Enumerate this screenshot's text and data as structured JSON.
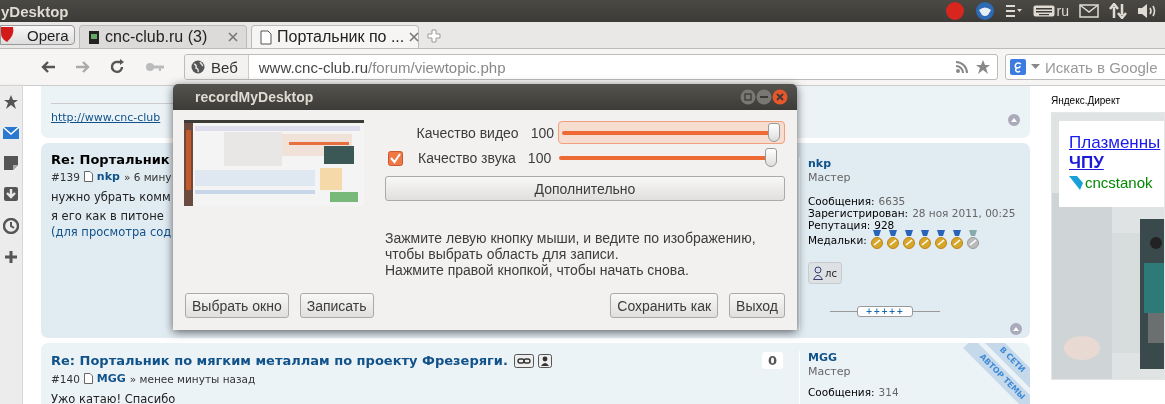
{
  "top_panel": {
    "title": "yDesktop",
    "keyboard_layout": "ru"
  },
  "browser": {
    "opera_button": "Opera",
    "tabs": [
      {
        "label": "cnc-club.ru (3)",
        "selected": false
      },
      {
        "label": "Портальник по ...",
        "selected": true
      }
    ],
    "address": {
      "scope": "Веб",
      "domain": "www.cnc-club.ru",
      "path": "/forum/viewtopic.php"
    },
    "search": {
      "placeholder": "Искать в Google"
    }
  },
  "posts": [
    {
      "kind": "tail",
      "link": "http://www.cnc-club"
    },
    {
      "kind": "post",
      "title": "Re: Портальник",
      "number": "#139",
      "author": "nkp",
      "time": "» 6 мину",
      "body": [
        "нужно убрать комм",
        "я его как в питоне"
      ],
      "hidden_note": "(для просмотра сод",
      "profile": {
        "name": "nkp",
        "rank": "Мастер",
        "stats": [
          {
            "label": "Сообщения:",
            "value": "6635"
          },
          {
            "label": "Зарегистрирован:",
            "value": "28 ноя 2011, 00:25"
          },
          {
            "label": "Репутация:",
            "value": "928"
          }
        ],
        "medals_label": "Медальки:",
        "medals": [
          {
            "kind": "gold"
          },
          {
            "kind": "gold"
          },
          {
            "kind": "gold"
          },
          {
            "kind": "gold"
          },
          {
            "kind": "gold"
          },
          {
            "kind": "gold"
          },
          {
            "kind": "silver"
          }
        ],
        "pm_button": "лс",
        "rating": "+++++"
      }
    },
    {
      "kind": "post",
      "title": "Re: Портальник по мягким металлам по проекту Фрезеряги.",
      "count": "0",
      "number": "#140",
      "author": "MGG",
      "time": "» менее минуты назад",
      "body": [
        "Ужо катаю! Спасибо"
      ],
      "profile": {
        "name": "MGG",
        "rank": "Мастер",
        "stats": [
          {
            "label": "Сообщения:",
            "value": "314"
          }
        ],
        "ribbon": [
          "В СЕТИ",
          "АВТОР ТЕМЫ"
        ]
      }
    }
  ],
  "ad": {
    "label": "Яндекс.Директ",
    "title_lines": [
      "Плазменны",
      "ЧПУ"
    ],
    "domain": "cncstanok"
  },
  "dialog": {
    "title": "recordMyDesktop",
    "sliders": [
      {
        "kind": "plain",
        "label": "Качество видео",
        "reading": "100",
        "level": 1,
        "focused": true
      },
      {
        "kind": "checkbox",
        "checked": true,
        "label": "Качество звука",
        "reading": "100",
        "level": 1,
        "focused": false
      }
    ],
    "advanced_button": "Дополнительно",
    "hint_lines": [
      "Зажмите левую кнопку мыши, и ведите по изображению,",
      "чтобы выбрать область для записи.",
      "Нажмите правой кнопкой, чтобы начать снова."
    ],
    "left_buttons": [
      "Выбрать окно",
      "Записать"
    ],
    "right_buttons": [
      "Сохранить как",
      "Выход"
    ]
  }
}
